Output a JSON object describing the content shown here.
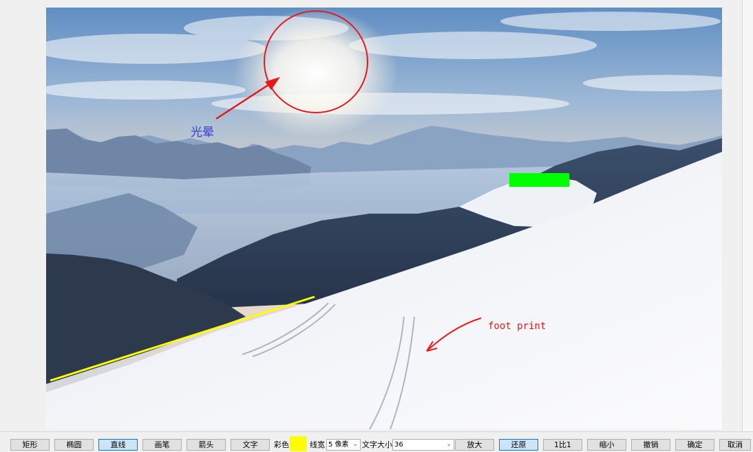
{
  "annotations": {
    "halo_label": "光晕",
    "footprint_label": "foot print",
    "colors": {
      "circle": "#e8181a",
      "arrow": "#e8181a",
      "halo_text": "#3a3adf",
      "line": "#ffff00",
      "rect": "#00ff00"
    }
  },
  "toolbar": {
    "rect_label": "矩形",
    "ellipse_label": "椭圆",
    "line_label": "直线",
    "pen_label": "画笔",
    "arrow_label": "箭头",
    "text_label": "文字",
    "color_label": "彩色",
    "color_value": "#ffff00",
    "linewidth_label": "线宽",
    "linewidth_value": "5 像素",
    "fontsize_label": "文字大小",
    "fontsize_value": "36",
    "zoom_in_label": "放大",
    "restore_label": "还原",
    "one_to_one_label": "1比1",
    "zoom_out_label": "缩小",
    "undo_label": "撤销",
    "ok_label": "确定",
    "cancel_label": "取消",
    "active_tool": "直线",
    "dropdown_icon": "chevron-down-icon"
  }
}
